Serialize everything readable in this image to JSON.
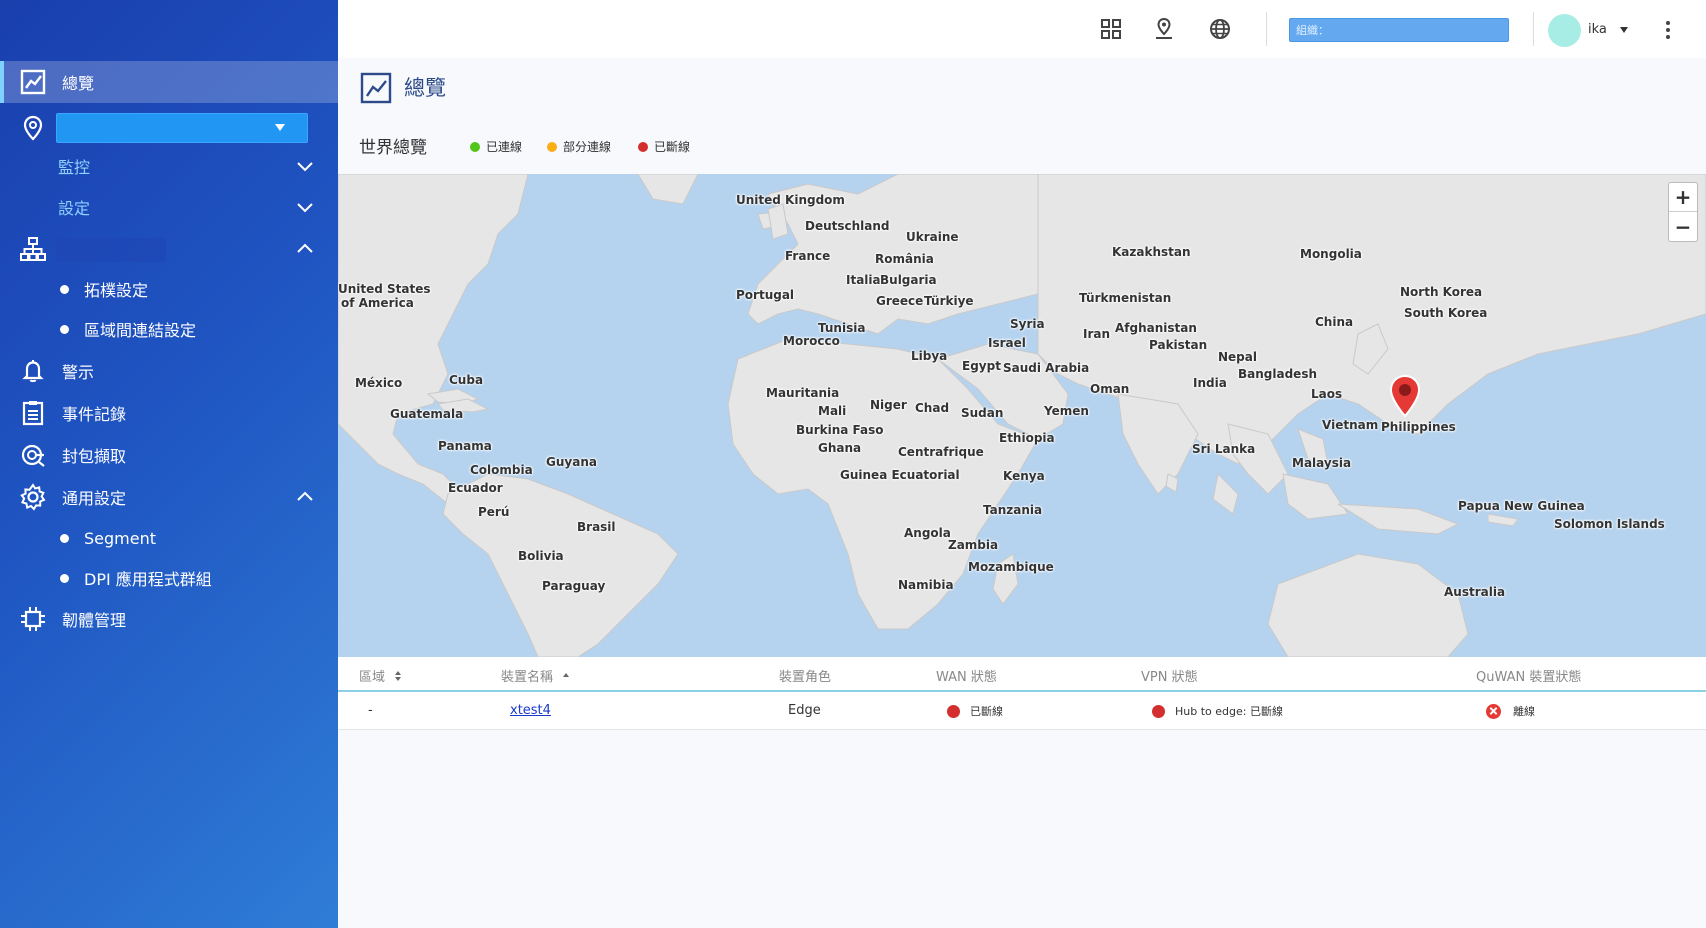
{
  "sidebar": {
    "overview_label": "總覽",
    "monitor_label": "監控",
    "settings_label": "設定",
    "topology_label": "拓樸設定",
    "region_link_label": "區域間連結設定",
    "alerts_label": "警示",
    "events_label": "事件記錄",
    "capture_label": "封包擷取",
    "general_label": "通用設定",
    "segment_label": "Segment",
    "dpi_label": "DPI 應用程式群組",
    "firmware_label": "韌體管理"
  },
  "topbar": {
    "org_placeholder": "組織：",
    "username": "ika"
  },
  "page": {
    "title": "總覽",
    "world_title": "世界總覽",
    "legend": [
      {
        "label": "已連線",
        "color": "#52c41a"
      },
      {
        "label": "部分連線",
        "color": "#faad14"
      },
      {
        "label": "已斷線",
        "color": "#d32f2f"
      }
    ]
  },
  "map": {
    "labels": {
      "uk": "United Kingdom",
      "de": "Deutschland",
      "ua": "Ukraine",
      "kz": "Kazakhstan",
      "mn": "Mongolia",
      "fr": "France",
      "ro": "România",
      "it": "Italia",
      "bg": "Bulgaria",
      "pt": "Portugal",
      "gr": "Greece",
      "tr": "Türkiye",
      "tm": "Türkmenistan",
      "nk": "North Korea",
      "us1": "United States",
      "us2": "of America",
      "sk": "South Korea",
      "cn": "China",
      "tn": "Tunisia",
      "sy": "Syria",
      "ir": "Iran",
      "af": "Afghanistan",
      "pk": "Pakistan",
      "il": "Israel",
      "ma": "Morocco",
      "np": "Nepal",
      "ly": "Libya",
      "eg": "Egypt",
      "sa": "Saudi Arabia",
      "bd": "Bangladesh",
      "mx": "México",
      "cu": "Cuba",
      "in": "India",
      "om": "Oman",
      "mr": "Mauritania",
      "la": "Laos",
      "ne": "Niger",
      "ml": "Mali",
      "gt": "Guatemala",
      "ye": "Yemen",
      "td": "Chad",
      "sd": "Sudan",
      "bf": "Burkina Faso",
      "vn": "Vietnam",
      "ph": "Philippines",
      "et": "Ethiopia",
      "gh": "Ghana",
      "pa": "Panama",
      "lk": "Sri Lanka",
      "cf": "Centrafrique",
      "my": "Malaysia",
      "co": "Colombia",
      "gy": "Guyana",
      "ke": "Kenya",
      "gq": "Guinea Ecuatorial",
      "ec": "Ecuador",
      "pe": "Perú",
      "tz": "Tanzania",
      "pg": "Papua New Guinea",
      "br": "Brasil",
      "sb": "Solomon Islands",
      "ao": "Angola",
      "zm": "Zambia",
      "bo": "Bolivia",
      "mz": "Mozambique",
      "na": "Namibia",
      "py": "Paraguay",
      "au": "Australia"
    },
    "zoom_in": "+",
    "zoom_out": "−"
  },
  "table": {
    "headers": {
      "region": "區域",
      "device_name": "裝置名稱",
      "device_role": "裝置角色",
      "wan_status": "WAN 狀態",
      "vpn_status": "VPN 狀態",
      "quwan_status": "QuWAN 裝置狀態"
    },
    "rows": [
      {
        "region": "-",
        "device_name": "xtest4",
        "device_role": "Edge",
        "wan_status": "已斷線",
        "vpn_status": "Hub to edge: 已斷線",
        "quwan_status": "離線"
      }
    ]
  }
}
